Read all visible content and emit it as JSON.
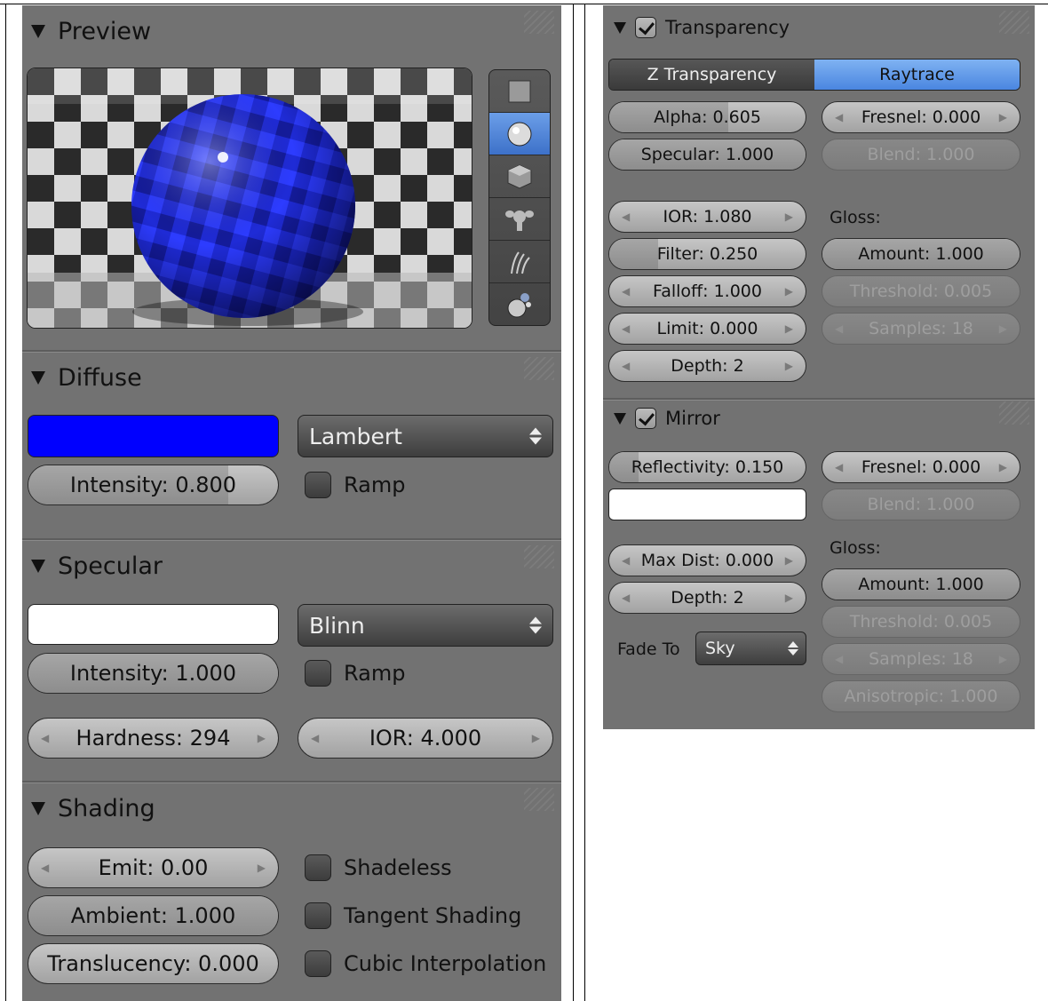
{
  "left_panel": {
    "preview": {
      "title": "Preview",
      "tabs": [
        {
          "name": "flat-icon",
          "selected": false
        },
        {
          "name": "sphere-icon",
          "selected": true
        },
        {
          "name": "cube-icon",
          "selected": false
        },
        {
          "name": "monkey-icon",
          "selected": false
        },
        {
          "name": "hair-icon",
          "selected": false
        },
        {
          "name": "sky-sphere-icon",
          "selected": false
        }
      ]
    },
    "diffuse": {
      "title": "Diffuse",
      "color": "#0000ff",
      "shader": "Lambert",
      "intensity": "Intensity: 0.800",
      "intensity_value": 0.8,
      "ramp": "Ramp"
    },
    "specular": {
      "title": "Specular",
      "color": "#ffffff",
      "shader": "Blinn",
      "intensity": "Intensity: 1.000",
      "intensity_value": 1.0,
      "ramp": "Ramp",
      "hardness": "Hardness: 294",
      "ior": "IOR: 4.000"
    },
    "shading": {
      "title": "Shading",
      "emit": "Emit: 0.00",
      "ambient": "Ambient: 1.000",
      "ambient_value": 1.0,
      "translucency": "Translucency: 0.000",
      "translucency_value": 0.0,
      "shadeless": "Shadeless",
      "tangent": "Tangent Shading",
      "cubic": "Cubic Interpolation"
    }
  },
  "right_panel": {
    "transparency": {
      "title": "Transparency",
      "enabled": true,
      "modes": [
        "Z Transparency",
        "Raytrace"
      ],
      "active_mode": "Raytrace",
      "alpha": "Alpha: 0.605",
      "alpha_value": 0.605,
      "fresnel": "Fresnel: 0.000",
      "specular": "Specular: 1.000",
      "specular_value": 1.0,
      "blend": "Blend: 1.000",
      "ior": "IOR: 1.080",
      "gloss_label": "Gloss:",
      "filter": "Filter: 0.250",
      "filter_value": 0.25,
      "amount": "Amount: 1.000",
      "falloff": "Falloff: 1.000",
      "threshold": "Threshold: 0.005",
      "limit": "Limit: 0.000",
      "samples": "Samples: 18",
      "depth": "Depth: 2"
    },
    "mirror": {
      "title": "Mirror",
      "enabled": true,
      "reflectivity": "Reflectivity: 0.150",
      "reflectivity_value": 0.15,
      "fresnel": "Fresnel: 0.000",
      "color": "#ffffff",
      "blend": "Blend: 1.000",
      "gloss_label": "Gloss:",
      "max_dist": "Max Dist: 0.000",
      "amount": "Amount: 1.000",
      "depth": "Depth: 2",
      "threshold": "Threshold: 0.005",
      "fade_to_label": "Fade To",
      "fade_to_value": "Sky",
      "samples": "Samples: 18",
      "anisotropic": "Anisotropic: 1.000"
    }
  },
  "colors": {
    "panel_bg": "#727272",
    "accent_blue": "#4a86e0"
  }
}
